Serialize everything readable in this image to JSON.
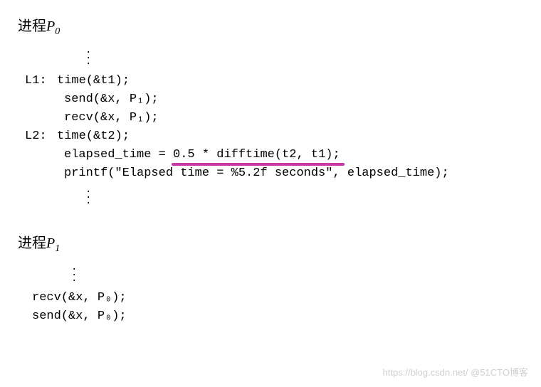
{
  "p0": {
    "heading_prefix": "进程",
    "heading_var": "P",
    "heading_sub": "0",
    "lines": {
      "l1_label": "L1:",
      "l1_code": "time(&t1);",
      "send": "send(&x, P₁);",
      "recv": "recv(&x, P₁);",
      "l2_label": "L2:",
      "l2_code": "time(&t2);",
      "elapsed_pre": "elapsed_time = ",
      "elapsed_underlined": "0.5 * difftime(t2, t1);",
      "printf": "printf(\"Elapsed time = %5.2f seconds\", elapsed_time);"
    }
  },
  "p1": {
    "heading_prefix": "进程",
    "heading_var": "P",
    "heading_sub": "1",
    "lines": {
      "recv": "recv(&x, P₀);",
      "send": "send(&x, P₀);"
    }
  },
  "watermark": "https://blog.csdn.net/    @51CTO博客"
}
